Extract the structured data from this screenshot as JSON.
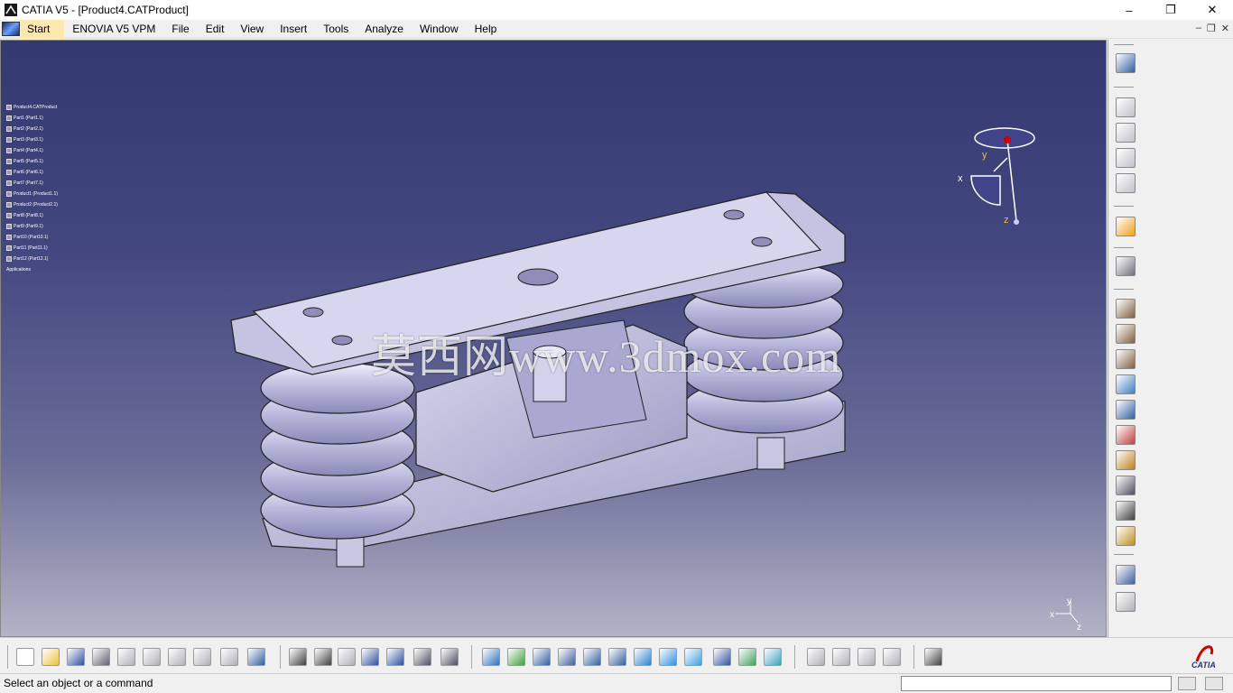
{
  "window": {
    "title": "CATIA V5 - [Product4.CATProduct]",
    "minimize": "–",
    "maximize": "❐",
    "close": "✕"
  },
  "menu": {
    "start": "Start",
    "items": [
      "ENOVIA V5 VPM",
      "File",
      "Edit",
      "View",
      "Insert",
      "Tools",
      "Analyze",
      "Window",
      "Help"
    ],
    "doc_controls": [
      "–",
      "❐",
      "✕"
    ]
  },
  "tree": {
    "root": "Product4.CATProduct",
    "nodes": [
      "Part1 (Part1.1)",
      "Part2 (Part2.1)",
      "Part3 (Part3.1)",
      "Part4 (Part4.1)",
      "Part5 (Part5.1)",
      "Part6 (Part6.1)",
      "Part7 (Part7.1)",
      "Product1 (Product1.1)",
      "Product2 (Product2.1)",
      "Part8 (Part8.1)",
      "Part9 (Part9.1)",
      "Part10 (Part10.1)",
      "Part11 (Part11.1)",
      "Part12 (Part12.1)"
    ],
    "footer": "Applications"
  },
  "watermark": "莫西网www.3dmox.com",
  "compass": {
    "x": "x",
    "y": "y",
    "z": "z"
  },
  "axis_triad": {
    "x": "x",
    "y": "y",
    "z": "z"
  },
  "status": {
    "message": "Select an object or a command",
    "input_placeholder": ""
  },
  "brand": {
    "logo_text": "CATIA",
    "accent": "#cc0000",
    "viewport_top": "#343870",
    "viewport_bottom": "#b3b3c6"
  },
  "right_toolbar_icons": [
    "camera-icon",
    "bill-of-material-icon",
    "product-icon-1",
    "product-icon-2",
    "product-icon-3",
    "select-arrow-icon",
    "fly-mode-icon",
    "gear-icon-1",
    "gear-icon-2",
    "gear-icon-3",
    "existing-component-icon",
    "replace-component-icon",
    "reorder-icon",
    "graph-tree-icon",
    "generate-numbering-icon",
    "selective-load-icon",
    "manage-representations-icon",
    "multi-instantiation-icon",
    "fast-multi-instantiation-icon"
  ],
  "bottom_toolbar_icons": [
    "new-icon",
    "open-icon",
    "save-icon",
    "print-icon",
    "cut-icon",
    "copy-icon",
    "paste-icon",
    "undo-icon",
    "redo-icon",
    "whats-this-icon",
    "formula-icon",
    "knowledge-icon",
    "measure-icon",
    "table-icon",
    "catalog-icon",
    "sketch-icon",
    "drafting-icon",
    "fly-icon",
    "fit-all-icon",
    "pan-icon",
    "rotate-icon",
    "zoom-in-icon",
    "zoom-out-icon",
    "normal-view-icon",
    "quick-view-icon",
    "iso-view-icon",
    "render-style-icon",
    "hide-show-icon",
    "swap-space-icon",
    "constraint-icon",
    "update-icon",
    "copy-paste-icon",
    "reorder-icon",
    "capture-icon"
  ]
}
